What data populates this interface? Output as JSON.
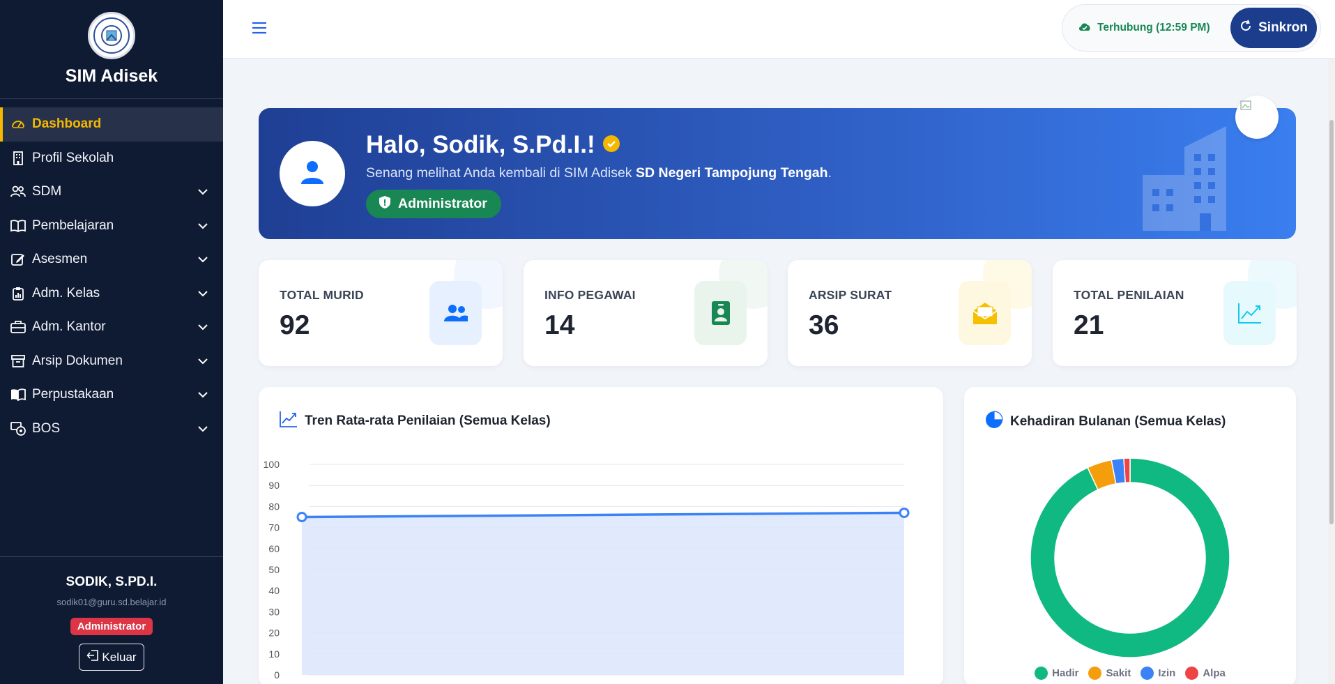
{
  "app": {
    "name": "SIM Adisek"
  },
  "sidebar": {
    "items": [
      {
        "label": "Dashboard",
        "icon": "speedometer-icon",
        "active": true,
        "expandable": false
      },
      {
        "label": "Profil Sekolah",
        "icon": "building-icon",
        "active": false,
        "expandable": false
      },
      {
        "label": "SDM",
        "icon": "people-icon",
        "active": false,
        "expandable": true
      },
      {
        "label": "Pembelajaran",
        "icon": "book-icon",
        "active": false,
        "expandable": true
      },
      {
        "label": "Asesmen",
        "icon": "pencil-square-icon",
        "active": false,
        "expandable": true
      },
      {
        "label": "Adm. Kelas",
        "icon": "clipboard-data-icon",
        "active": false,
        "expandable": true
      },
      {
        "label": "Adm. Kantor",
        "icon": "briefcase-icon",
        "active": false,
        "expandable": true
      },
      {
        "label": "Arsip Dokumen",
        "icon": "archive-icon",
        "active": false,
        "expandable": true
      },
      {
        "label": "Perpustakaan",
        "icon": "book-open-icon",
        "active": false,
        "expandable": true
      },
      {
        "label": "BOS",
        "icon": "cash-coin-icon",
        "active": false,
        "expandable": true
      }
    ],
    "user": {
      "name": "SODIK, S.PD.I.",
      "email": "sodik01@guru.sd.belajar.id",
      "role": "Administrator",
      "logout_label": "Keluar"
    }
  },
  "topbar": {
    "status": "Terhubung (12:59 PM)",
    "sync_label": "Sinkron"
  },
  "welcome": {
    "greeting": "Halo, Sodik, S.Pd.I.!",
    "subtitle_prefix": "Senang melihat Anda kembali di SIM Adisek ",
    "school": "SD Negeri Tampojung Tengah",
    "subtitle_suffix": ".",
    "role": "Administrator"
  },
  "stats": [
    {
      "label": "TOTAL MURID",
      "value": "92",
      "icon": "people-fill-icon",
      "color": "#0d6efd",
      "bg": "#e7f0ff"
    },
    {
      "label": "INFO PEGAWAI",
      "value": "14",
      "icon": "person-badge-icon",
      "color": "#198754",
      "bg": "#e8f4ec"
    },
    {
      "label": "ARSIP SURAT",
      "value": "36",
      "icon": "envelope-open-icon",
      "color": "#f5c000",
      "bg": "#fff8e0"
    },
    {
      "label": "TOTAL PENILAIAN",
      "value": "21",
      "icon": "graph-up-icon",
      "color": "#0dcaf0",
      "bg": "#e6f9fd"
    }
  ],
  "trend_panel": {
    "title": "Tren Rata-rata Penilaian (Semua Kelas)"
  },
  "attendance_panel": {
    "title": "Kehadiran Bulanan (Semua Kelas)"
  },
  "chart_data": [
    {
      "type": "area",
      "title": "Tren Rata-rata Penilaian (Semua Kelas)",
      "xlabel": "",
      "ylabel": "",
      "ylim": [
        0,
        100
      ],
      "yticks": [
        0,
        10,
        20,
        30,
        40,
        50,
        60,
        70,
        80,
        90,
        100
      ],
      "grid": true,
      "series": [
        {
          "values": [
            75,
            77
          ],
          "color": "#3b82f6"
        }
      ]
    },
    {
      "type": "pie",
      "title": "Kehadiran Bulanan (Semua Kelas)",
      "donut": true,
      "legend_position": "bottom",
      "categories": [
        "Hadir",
        "Sakit",
        "Izin",
        "Alpa"
      ],
      "values": [
        93,
        4,
        2,
        1
      ],
      "colors": [
        "#10b981",
        "#f59e0b",
        "#3b82f6",
        "#ef4444"
      ]
    }
  ]
}
